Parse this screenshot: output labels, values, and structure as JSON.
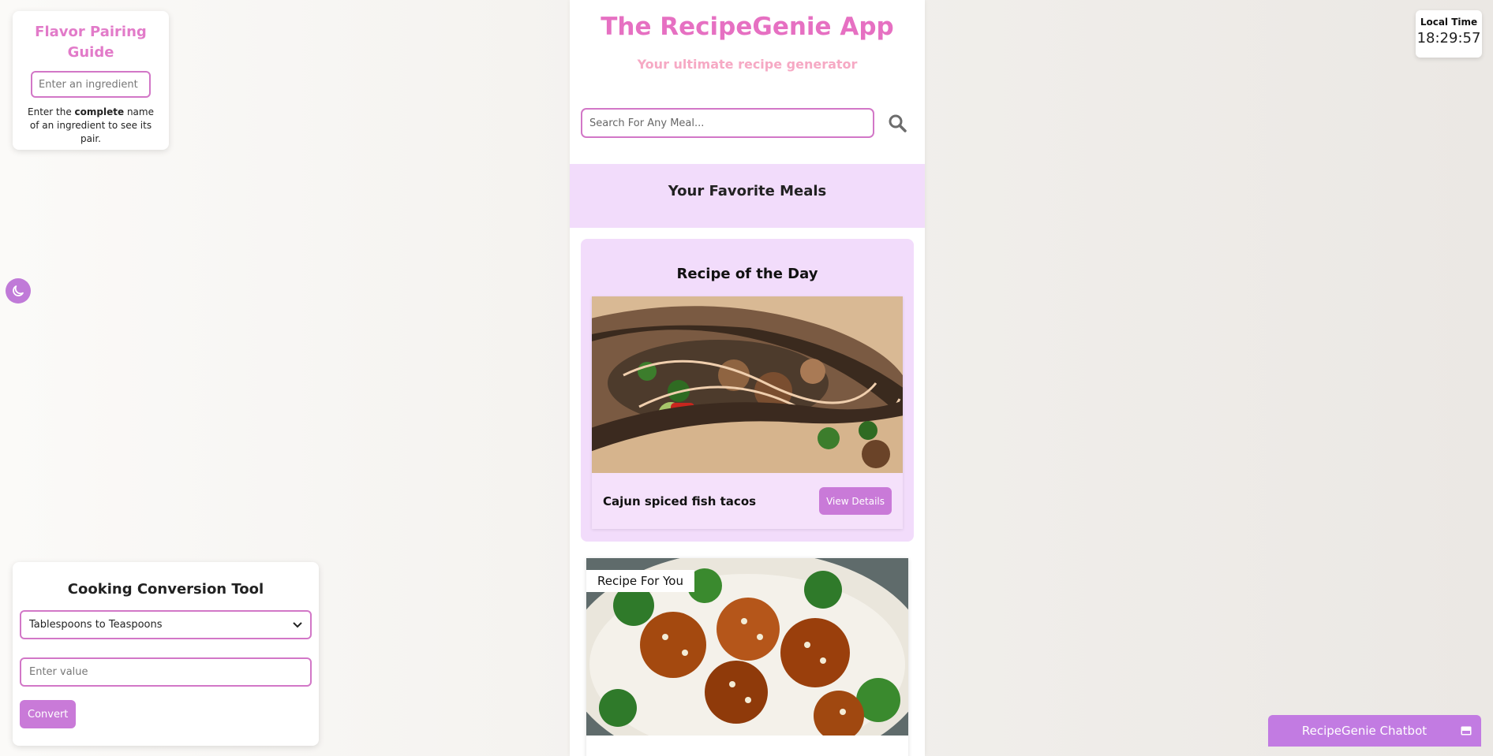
{
  "flavor": {
    "title": "Flavor Pairing Guide",
    "input_placeholder": "Enter an ingredient",
    "note_before": "Enter the ",
    "note_bold": "complete",
    "note_after": " name of an ingredient to see its pair."
  },
  "theme_toggle": {
    "icon": "moon-icon"
  },
  "conversion": {
    "title": "Cooking Conversion Tool",
    "selected_option": "Tablespoons to Teaspoons",
    "value_placeholder": "Enter value",
    "convert_label": "Convert"
  },
  "header": {
    "title": "The RecipeGenie App",
    "subtitle": "Your ultimate recipe generator",
    "search_placeholder": "Search For Any Meal..."
  },
  "favorites": {
    "title": "Your Favorite Meals"
  },
  "recipe_of_day": {
    "title": "Recipe of the Day",
    "meal_name": "Cajun spiced fish tacos",
    "button_label": "View Details"
  },
  "recipe_for_you": {
    "badge": "Recipe For You"
  },
  "clock": {
    "label": "Local Time",
    "time": "18:29:57"
  },
  "chatbot": {
    "label": "RecipeGenie Chatbot"
  },
  "colors": {
    "accent_pink": "#e670c2",
    "accent_purple": "#c97ad8",
    "lavender_bg": "#f2dcfb",
    "border": "#d277c7"
  }
}
